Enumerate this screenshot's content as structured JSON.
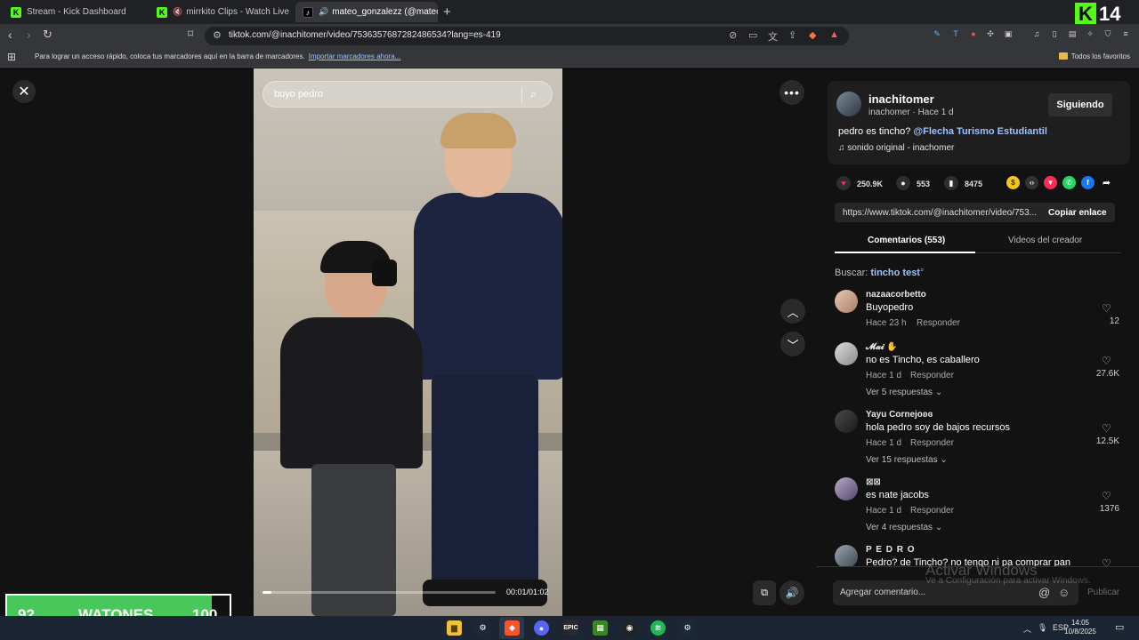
{
  "browser": {
    "tabs": [
      {
        "title": "Stream - Kick Dashboard"
      },
      {
        "title": "mirrkito Clips - Watch Live on Kick"
      },
      {
        "title": "mateo_gonzalezz (@mateo.g"
      }
    ],
    "url": "tiktok.com/@inachitomer/video/7536357687282486534?lang=es-419",
    "bookmarks_prompt": "Para lograr un acceso rápido, coloca tus marcadores aquí en la barra de marcadores.",
    "bookmarks_import": "Importar marcadores ahora...",
    "bookmarks_all": "Todos los favoritos"
  },
  "kick_overlay": {
    "logo_letter": "K",
    "number": "14"
  },
  "video": {
    "search_text": "buyo pedro",
    "time": "00:01/01:02",
    "progress": 0.04
  },
  "post": {
    "username": "inachitomer",
    "subline": "inachomer · Hace 1 d",
    "follow_label": "Siguiendo",
    "caption": "pedro es tincho?",
    "mention": "@Flecha Turismo Estudiantil",
    "sound": "sonido original - inachomer",
    "likes": "250.9K",
    "comments": "553",
    "saves": "8475",
    "link": "https://www.tiktok.com/@inachitomer/video/753...",
    "copy_label": "Copiar enlace"
  },
  "panel_tabs": {
    "comments": "Comentarios (553)",
    "creator": "Videos del creador"
  },
  "search": {
    "label": "Buscar:",
    "query": "tincho test"
  },
  "comments": [
    {
      "user": "nazaacorbetto",
      "text": "Buyopedro",
      "time": "Hace 23 h",
      "reply": "Responder",
      "likes": "12",
      "more": ""
    },
    {
      "user": "𝓜𝓪𝓲 ✋",
      "text": "no es Tincho, es caballero",
      "time": "Hace 1 d",
      "reply": "Responder",
      "likes": "27.6K",
      "more": "Ver 5 respuestas"
    },
    {
      "user": "Yayu Cornejoʚɞ",
      "text": "hola pedro soy de bajos recursos",
      "time": "Hace 1 d",
      "reply": "Responder",
      "likes": "12.5K",
      "more": "Ver 15 respuestas"
    },
    {
      "user": "⊠⊠",
      "text": "es nate jacobs",
      "time": "Hace 1 d",
      "reply": "Responder",
      "likes": "1376",
      "more": "Ver 4 respuestas"
    },
    {
      "user": "P E D R O",
      "text": "Pedro? de Tincho? no tengo ni pa comprar pan",
      "time": "",
      "reply": "",
      "likes": "",
      "more": ""
    }
  ],
  "comment_bar": {
    "placeholder": "Agregar comentario...",
    "post": "Publicar"
  },
  "windows_watermark": {
    "title": "Activar Windows",
    "subtitle": "Ve a Configuración para activar Windows."
  },
  "stream_overlay": {
    "left": "92",
    "label": "WATONES",
    "right": "100",
    "fill_ratio": 0.92,
    "color": "#48c75a"
  },
  "taskbar": {
    "lang": "ESP",
    "time": "14:05",
    "date": "10/8/2025"
  },
  "colors": {
    "kick_green": "#53fc18",
    "tiktok_red": "#fe2c55",
    "link_blue": "#9ec2ff"
  }
}
